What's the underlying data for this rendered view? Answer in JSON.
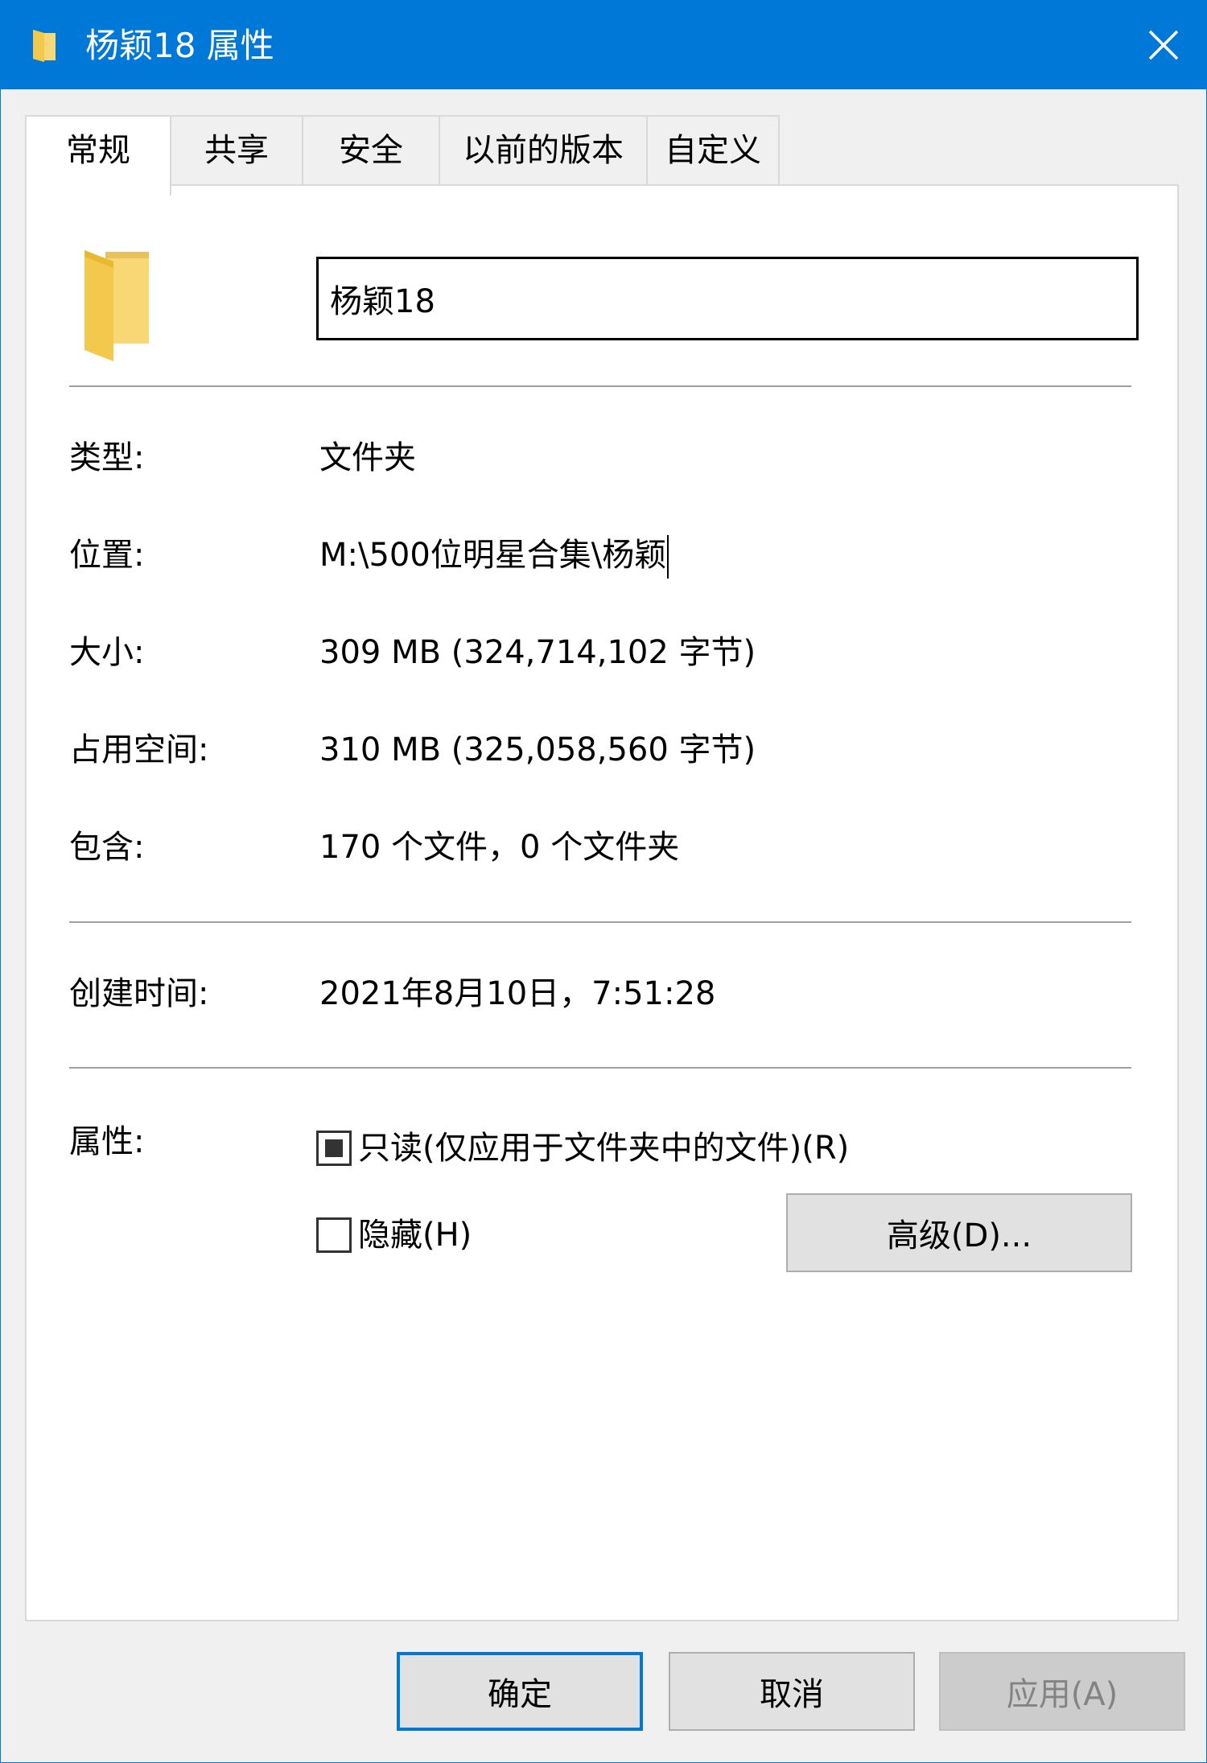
{
  "window": {
    "title": "杨颖18 属性",
    "accent_color": "#0078d7"
  },
  "tabs": [
    {
      "label": "常规",
      "active": true
    },
    {
      "label": "共享",
      "active": false
    },
    {
      "label": "安全",
      "active": false
    },
    {
      "label": "以前的版本",
      "active": false
    },
    {
      "label": "自定义",
      "active": false
    }
  ],
  "general": {
    "folder_name": "杨颖18",
    "type_label": "类型:",
    "type_value": "文件夹",
    "location_label": "位置:",
    "location_value": "M:\\500位明星合集\\杨颖",
    "size_label": "大小:",
    "size_value": "309 MB (324,714,102 字节)",
    "size_on_disk_label": "占用空间:",
    "size_on_disk_value": "310 MB (325,058,560 字节)",
    "contains_label": "包含:",
    "contains_value": "170 个文件，0 个文件夹",
    "created_label": "创建时间:",
    "created_value": "2021年8月10日，7:51:28",
    "attributes_label": "属性:",
    "readonly_label": "只读(仅应用于文件夹中的文件)(R)",
    "readonly_state": "indeterminate",
    "hidden_label": "隐藏(H)",
    "hidden_state": "unchecked",
    "advanced_button": "高级(D)..."
  },
  "footer": {
    "ok": "确定",
    "cancel": "取消",
    "apply": "应用(A)"
  },
  "icons": {
    "title": "folder-icon",
    "close": "close-icon",
    "large": "folder-icon"
  }
}
